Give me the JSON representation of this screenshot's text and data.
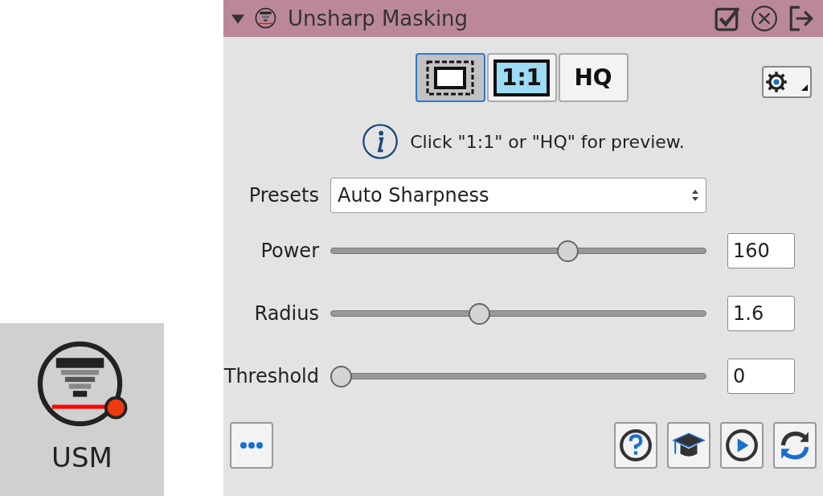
{
  "tile": {
    "label": "USM"
  },
  "panel": {
    "title": "Unsharp Masking",
    "expanded": true
  },
  "preview_modes": [
    {
      "kind": "frame",
      "selected": true
    },
    {
      "kind": "text",
      "label": "1:1",
      "selected": false
    },
    {
      "kind": "text",
      "label": "HQ",
      "selected": false
    }
  ],
  "info": "Click \"1:1\" or \"HQ\" for preview.",
  "presets": {
    "label": "Presets",
    "value": "Auto Sharpness"
  },
  "sliders": [
    {
      "name": "Power",
      "level": 0.64,
      "value": "160"
    },
    {
      "name": "Radius",
      "level": 0.39,
      "value": "1.6"
    },
    {
      "name": "Threshold",
      "level": 0,
      "value": "0"
    }
  ]
}
